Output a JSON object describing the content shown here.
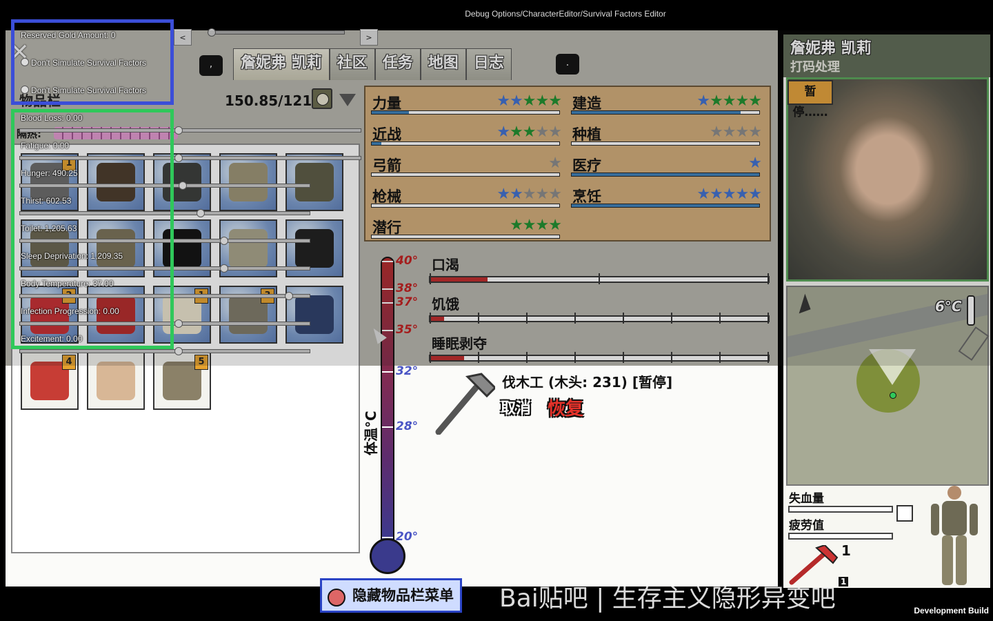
{
  "window": {
    "title": "Debug Options/CharacterEditor/Survival Factors Editor",
    "build_label": "Development Build"
  },
  "nav": {
    "prev": "<",
    "next": ">",
    "left_key": ",",
    "right_key": "."
  },
  "tabs": [
    {
      "label": "詹妮弗 凯莉"
    },
    {
      "label": "社区"
    },
    {
      "label": "任务"
    },
    {
      "label": "地图"
    },
    {
      "label": "日志"
    }
  ],
  "inventory": {
    "title": "物品栏",
    "weight": "150.85/121 磅",
    "heat_label": "隔热:",
    "slots": [
      {
        "name": "crowbar",
        "badge": "1",
        "color": "#6b6b6b"
      },
      {
        "name": "boots",
        "badge": "",
        "color": "#4a3a2a"
      },
      {
        "name": "vest",
        "badge": "",
        "color": "#3a3c3a"
      },
      {
        "name": "beanie",
        "badge": "",
        "color": "#9d9476"
      },
      {
        "name": "backpack",
        "badge": "",
        "color": "#5c5b45"
      },
      {
        "name": "camo-jacket",
        "badge": "",
        "color": "#6a6450"
      },
      {
        "name": "camo-pants",
        "badge": "",
        "color": "#7a7258"
      },
      {
        "name": "sunglasses",
        "badge": "",
        "color": "#111111"
      },
      {
        "name": "water-bottle",
        "badge": "",
        "color": "#a9a48a"
      },
      {
        "name": "katana",
        "badge": "",
        "color": "#1e1e1e"
      },
      {
        "name": "skill-book",
        "badge": "2",
        "color": "#c72e33"
      },
      {
        "name": "hatchet",
        "badge": "",
        "color": "#b52a2a"
      },
      {
        "name": "magazine",
        "badge": "1",
        "color": "#ece4cf"
      },
      {
        "name": "cloth",
        "badge": "3",
        "color": "#7f7a6a"
      },
      {
        "name": "gadget",
        "badge": "",
        "color": "#2c3f6b"
      },
      {
        "name": "handyman-guide",
        "badge": "4",
        "color": "#c73d35"
      },
      {
        "name": "food-container",
        "badge": "",
        "color": "#d8b796"
      },
      {
        "name": "wood-planks",
        "badge": "5",
        "color": "#8b8168"
      }
    ]
  },
  "skills": [
    {
      "name": "力量",
      "filled": 3,
      "total": 5,
      "blue": 2,
      "progress": 0.2
    },
    {
      "name": "建造",
      "filled": 4,
      "total": 5,
      "blue": 1,
      "progress": 0.9
    },
    {
      "name": "近战",
      "filled": 2,
      "total": 5,
      "blue": 1,
      "progress": 0.05
    },
    {
      "name": "种植",
      "filled": 0,
      "total": 4,
      "blue": 0,
      "progress": 0.0
    },
    {
      "name": "弓箭",
      "filled": 0,
      "total": 1,
      "blue": 0,
      "progress": 0.0
    },
    {
      "name": "医疗",
      "filled": 0,
      "total": 1,
      "blue": 1,
      "progress": 1.0
    },
    {
      "name": "枪械",
      "filled": 0,
      "total": 5,
      "blue": 2,
      "progress": 0.0
    },
    {
      "name": "烹饪",
      "filled": 0,
      "total": 5,
      "blue": 5,
      "progress": 1.0
    },
    {
      "name": "潜行",
      "filled": 4,
      "total": 4,
      "blue": 0,
      "progress": 0.0
    }
  ],
  "thermometer": {
    "caption": "体温°C",
    "ticks": [
      {
        "label": "40°",
        "kind": "hot"
      },
      {
        "label": "38°",
        "kind": "hot"
      },
      {
        "label": "37°",
        "kind": "hot"
      },
      {
        "label": "35°",
        "kind": "hot"
      },
      {
        "label": "32°",
        "kind": "cold"
      },
      {
        "label": "28°",
        "kind": "cold"
      },
      {
        "label": "20°",
        "kind": "cold"
      }
    ]
  },
  "needs": [
    {
      "label": "口渴",
      "fill": 0.17
    },
    {
      "label": "饥饿",
      "fill": 0.04
    },
    {
      "label": "睡眠剥夺",
      "fill": 0.1
    }
  ],
  "action": {
    "text": "伐木工 (木头: 231) [暂停]",
    "cancel": "取消",
    "resume": "恢复"
  },
  "character": {
    "name": "詹妮弗 凯莉",
    "task": "打码处理",
    "status": "暂停……"
  },
  "map": {
    "temperature": "6°C"
  },
  "vitals": [
    {
      "label": "失血量"
    },
    {
      "label": "疲劳值"
    }
  ],
  "equipped": {
    "count": "1",
    "count2": "1"
  },
  "hide_menu": "隐藏物品栏菜单",
  "watermark": "Bai贴吧 | 生存主义隐形异变吧",
  "debug": {
    "reserved_gold": "Reserved Gold Amount: 0",
    "option1": "Don't Simulate Survival Factors",
    "option2": "Don't Simulate Survival Factors",
    "factors": [
      "Blood Loss: 0.00",
      "Fatigue: 0.00",
      "Hunger: 490.25",
      "Thirst: 602.53",
      "Toilet: 1,205.63",
      "Sleep Deprivation: 1,209.35",
      "Body Temperature: 37.00",
      "Infection Progression: 0.00",
      "Excitement: 0.00"
    ]
  },
  "colors": {
    "accent": "#3b4ed8",
    "highlight": "#2fc85a",
    "panel": "#d2ad79",
    "star_green": "#1e8f2e",
    "star_blue": "#3f6fd0",
    "star_empty": "#8a8a8a"
  }
}
